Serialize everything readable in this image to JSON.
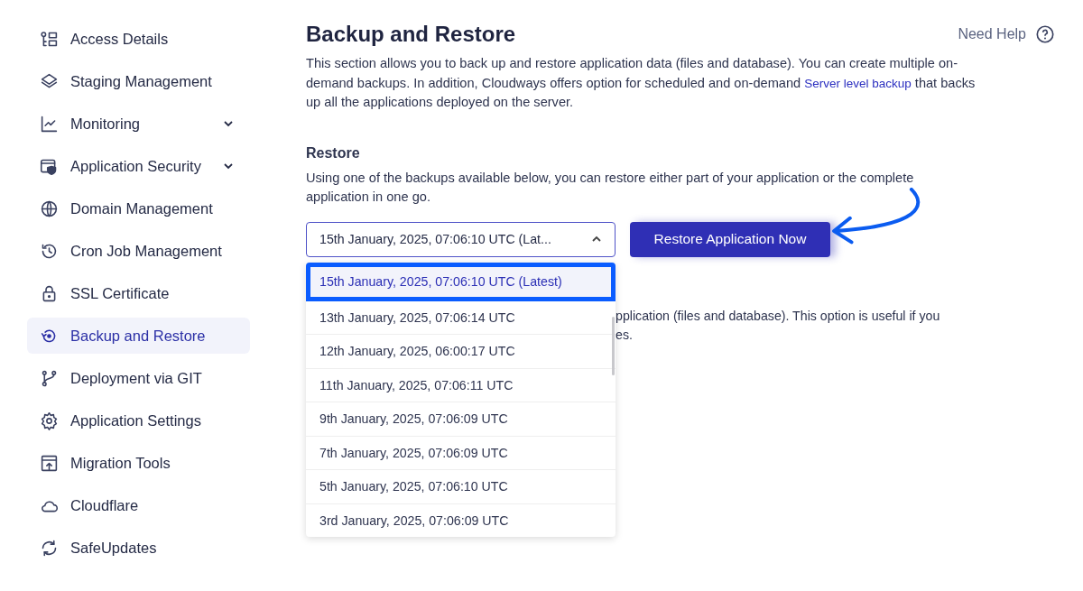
{
  "sidebar": {
    "items": [
      {
        "label": "Access Details",
        "selected": false,
        "expandable": false
      },
      {
        "label": "Staging Management",
        "selected": false,
        "expandable": false
      },
      {
        "label": "Monitoring",
        "selected": false,
        "expandable": true
      },
      {
        "label": "Application Security",
        "selected": false,
        "expandable": true
      },
      {
        "label": "Domain Management",
        "selected": false,
        "expandable": false
      },
      {
        "label": "Cron Job Management",
        "selected": false,
        "expandable": false
      },
      {
        "label": "SSL Certificate",
        "selected": false,
        "expandable": false
      },
      {
        "label": "Backup and Restore",
        "selected": true,
        "expandable": false
      },
      {
        "label": "Deployment via GIT",
        "selected": false,
        "expandable": false
      },
      {
        "label": "Application Settings",
        "selected": false,
        "expandable": false
      },
      {
        "label": "Migration Tools",
        "selected": false,
        "expandable": false
      },
      {
        "label": "Cloudflare",
        "selected": false,
        "expandable": false
      },
      {
        "label": "SafeUpdates",
        "selected": false,
        "expandable": false
      }
    ]
  },
  "header": {
    "title": "Backup and Restore",
    "help": "Need Help"
  },
  "intro": {
    "before": "This section allows you to back up and restore application data (files and database). You can create multiple on-demand backups. In addition, Cloudways offers option for scheduled and on-demand",
    "link": "Server level backup",
    "after": "that backs up all the applications deployed on the server."
  },
  "restore": {
    "heading": "Restore",
    "description": "Using one of the backups available below, you can restore either part of your application or the complete application in one go.",
    "select": {
      "value": "15th January, 2025, 07:06:10 UTC (Lat...",
      "expanded": true
    },
    "button": "Restore Application Now",
    "options": [
      {
        "label": "15th January, 2025, 07:06:10 UTC (Latest)",
        "selected": true
      },
      {
        "label": "13th January, 2025, 07:06:14 UTC",
        "selected": false
      },
      {
        "label": "12th January, 2025, 06:00:17 UTC",
        "selected": false
      },
      {
        "label": "11th January, 2025, 07:06:11 UTC",
        "selected": false
      },
      {
        "label": "9th January, 2025, 07:06:09 UTC",
        "selected": false
      },
      {
        "label": "7th January, 2025, 07:06:09 UTC",
        "selected": false
      },
      {
        "label": "5th January, 2025, 07:06:10 UTC",
        "selected": false
      },
      {
        "label": "3rd January, 2025, 07:06:09 UTC",
        "selected": false
      }
    ]
  },
  "hidden_text": [
    "pplication (files and database). This option is useful if you",
    "es."
  ]
}
